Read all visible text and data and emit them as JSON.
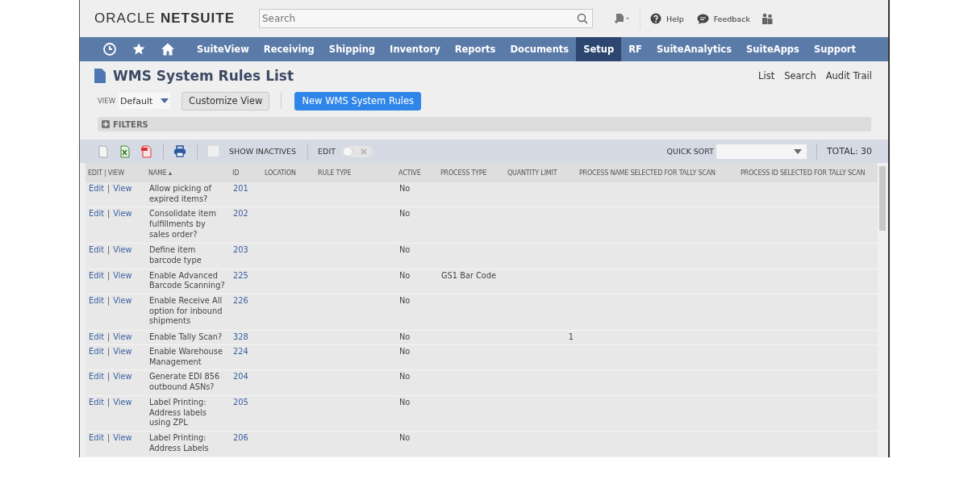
{
  "header": {
    "logo_oracle": "ORACLE",
    "logo_netsuite": "NETSUITE",
    "search": {
      "placeholder": "Search"
    },
    "help": "Help",
    "feedback": "Feedback"
  },
  "nav": [
    {
      "label": "SuiteView",
      "selected": false
    },
    {
      "label": "Receiving",
      "selected": false
    },
    {
      "label": "Shipping",
      "selected": false
    },
    {
      "label": "Inventory",
      "selected": false
    },
    {
      "label": "Reports",
      "selected": false
    },
    {
      "label": "Documents",
      "selected": false
    },
    {
      "label": "Setup",
      "selected": true
    },
    {
      "label": "RF",
      "selected": false
    },
    {
      "label": "SuiteAnalytics",
      "selected": false
    },
    {
      "label": "SuiteApps",
      "selected": false
    },
    {
      "label": "Support",
      "selected": false
    }
  ],
  "page": {
    "title": "WMS System Rules List",
    "links": [
      "List",
      "Search",
      "Audit Trail"
    ],
    "view_label": "VIEW",
    "view_value": "Default",
    "customize": "Customize View",
    "new_button": "New WMS System Rules",
    "filters": "FILTERS"
  },
  "toolbar": {
    "show_inactives": {
      "label": "SHOW INACTIVES",
      "checked": false
    },
    "edit": {
      "label": "EDIT",
      "on": false
    },
    "quick_sort": "QUICK SORT",
    "total": "TOTAL: 30"
  },
  "table": {
    "columns": [
      "EDIT | VIEW",
      "NAME ▴",
      "ID",
      "LOCATION",
      "RULE TYPE",
      "ACTIVE",
      "PROCESS TYPE",
      "QUANTITY LIMIT",
      "PROCESS NAME SELECTED FOR TALLY SCAN",
      "PROCESS ID SELECTED FOR TALLY SCAN"
    ],
    "rows": [
      {
        "edit": "Edit",
        "sep": "|",
        "view": "View",
        "name": "Allow picking of expired items?",
        "id": "201",
        "active": "No"
      },
      {
        "edit": "Edit",
        "sep": "|",
        "view": "View",
        "name": "Consolidate item fulfillments by sales order?",
        "id": "202",
        "active": "No"
      },
      {
        "edit": "Edit",
        "sep": "|",
        "view": "View",
        "name": "Define item barcode type",
        "id": "203",
        "active": "No"
      },
      {
        "edit": "Edit",
        "sep": "|",
        "view": "View",
        "name": "Enable Advanced Barcode Scanning?",
        "id": "225",
        "active": "No",
        "process_type": "GS1 Bar Code"
      },
      {
        "edit": "Edit",
        "sep": "|",
        "view": "View",
        "name": "Enable Receive All option for inbound shipments",
        "id": "226",
        "active": "No"
      },
      {
        "edit": "Edit",
        "sep": "|",
        "view": "View",
        "name": "Enable Tally Scan?",
        "id": "328",
        "active": "No",
        "quantity_limit": "1"
      },
      {
        "edit": "Edit",
        "sep": "|",
        "view": "View",
        "name": "Enable Warehouse Management",
        "id": "224",
        "active": "No"
      },
      {
        "edit": "Edit",
        "sep": "|",
        "view": "View",
        "name": "Generate EDI 856 outbound ASNs?",
        "id": "204",
        "active": "No"
      },
      {
        "edit": "Edit",
        "sep": "|",
        "view": "View",
        "name": "Label Printing: Address labels using ZPL",
        "id": "205",
        "active": "No"
      },
      {
        "edit": "Edit",
        "sep": "|",
        "view": "View",
        "name": "Label Printing: Address Labels",
        "id": "206",
        "active": "No"
      }
    ]
  }
}
